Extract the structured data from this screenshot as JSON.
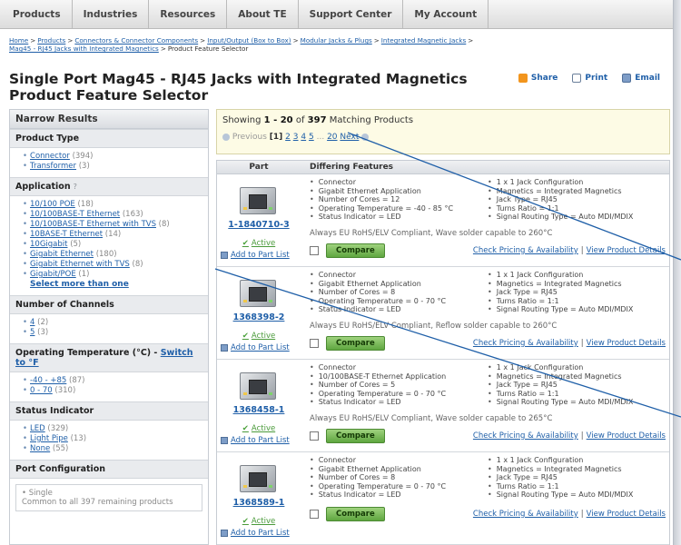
{
  "nav": {
    "items": [
      "Products",
      "Industries",
      "Resources",
      "About TE",
      "Support Center",
      "My Account"
    ]
  },
  "breadcrumb": {
    "links": [
      "Home",
      "Products",
      "Connectors & Connector Components",
      "Input/Output (Box to Box)",
      "Modular Jacks & Plugs",
      "Integrated Magnetic Jacks",
      "Mag45 - RJ45 Jacks with Integrated Magnetics"
    ],
    "current": "Product Feature Selector",
    "separator": ">"
  },
  "title": {
    "line1": "Single Port Mag45 - RJ45 Jacks with Integrated Magnetics",
    "line2": "Product Feature Selector"
  },
  "actions": {
    "share": "Share",
    "print": "Print",
    "email": "Email"
  },
  "sidebar": {
    "header": "Narrow Results",
    "product_type": {
      "title": "Product Type",
      "items": [
        {
          "label": "Connector",
          "count": "(394)"
        },
        {
          "label": "Transformer",
          "count": "(3)"
        }
      ]
    },
    "application": {
      "title": "Application",
      "help": "?",
      "items": [
        {
          "label": "10/100 POE",
          "count": "(18)"
        },
        {
          "label": "10/100BASE-T Ethernet",
          "count": "(163)"
        },
        {
          "label": "10/100BASE-T Ethernet with TVS",
          "count": "(8)"
        },
        {
          "label": "10BASE-T Ethernet",
          "count": "(14)"
        },
        {
          "label": "10Gigabit",
          "count": "(5)"
        },
        {
          "label": "Gigabit Ethernet",
          "count": "(180)"
        },
        {
          "label": "Gigabit Ethernet with TVS",
          "count": "(8)"
        },
        {
          "label": "Gigabit/POE",
          "count": "(1)"
        }
      ],
      "select_more": "Select more than one"
    },
    "channels": {
      "title": "Number of Channels",
      "items": [
        {
          "label": "4",
          "count": "(2)"
        },
        {
          "label": "5",
          "count": "(3)"
        }
      ]
    },
    "temperature": {
      "title": "Operating Temperature (°C) -",
      "switch": "Switch to °F",
      "items": [
        {
          "label": "-40 - +85",
          "count": "(87)"
        },
        {
          "label": "0 - 70",
          "count": "(310)"
        }
      ]
    },
    "status": {
      "title": "Status Indicator",
      "items": [
        {
          "label": "LED",
          "count": "(329)"
        },
        {
          "label": "Light Pipe",
          "count": "(13)"
        },
        {
          "label": "None",
          "count": "(55)"
        }
      ]
    },
    "port": {
      "title": "Port Configuration",
      "value": "Single",
      "note": "Common to all 397 remaining products"
    }
  },
  "results": {
    "showing_prefix": "Showing",
    "range": "1 - 20",
    "of": "of",
    "total": "397",
    "suffix": "Matching Products",
    "pager": {
      "previous": "Previous",
      "current": "[1]",
      "pages": [
        "2",
        "3",
        "4",
        "5"
      ],
      "ellipsis": "...",
      "last": "20",
      "next": "Next"
    },
    "columns": [
      "Part",
      "Differing Features"
    ],
    "rows": [
      {
        "part": "1-1840710-3",
        "status": "Active",
        "add": "Add to Part List",
        "left": [
          "Connector",
          "Gigabit Ethernet Application",
          "Number of Cores = 12",
          "Operating Temperature = -40 - 85 °C",
          "Status Indicator = LED"
        ],
        "right": [
          "1 x 1 Jack Configuration",
          "Magnetics = Integrated Magnetics",
          "Jack Type = RJ45",
          "Turns Ratio = 1:1",
          "Signal Routing Type = Auto MDI/MDIX"
        ],
        "rohs": "Always EU RoHS/ELV Compliant, Wave solder capable to 260°C",
        "compare": "Compare",
        "pricing": "Check Pricing & Availability",
        "details": "View Product Details"
      },
      {
        "part": "1368398-2",
        "status": "Active",
        "add": "Add to Part List",
        "left": [
          "Connector",
          "Gigabit Ethernet Application",
          "Number of Cores = 8",
          "Operating Temperature = 0 - 70 °C",
          "Status Indicator = LED"
        ],
        "right": [
          "1 x 1 Jack Configuration",
          "Magnetics = Integrated Magnetics",
          "Jack Type = RJ45",
          "Turns Ratio = 1:1",
          "Signal Routing Type = Auto MDI/MDIX"
        ],
        "rohs": "Always EU RoHS/ELV Compliant, Reflow solder capable to 260°C",
        "compare": "Compare",
        "pricing": "Check Pricing & Availability",
        "details": "View Product Details"
      },
      {
        "part": "1368458-1",
        "status": "Active",
        "add": "Add to Part List",
        "left": [
          "Connector",
          "10/100BASE-T Ethernet Application",
          "Number of Cores = 5",
          "Operating Temperature = 0 - 70 °C",
          "Status Indicator = LED"
        ],
        "right": [
          "1 x 1 Jack Configuration",
          "Magnetics = Integrated Magnetics",
          "Jack Type = RJ45",
          "Turns Ratio = 1:1",
          "Signal Routing Type = Auto MDI/MDIX"
        ],
        "rohs": "Always EU RoHS/ELV Compliant, Wave solder capable to 265°C",
        "compare": "Compare",
        "pricing": "Check Pricing & Availability",
        "details": "View Product Details"
      },
      {
        "part": "1368589-1",
        "status": "Active",
        "add": "Add to Part List",
        "left": [
          "Connector",
          "Gigabit Ethernet Application",
          "Number of Cores = 8",
          "Operating Temperature = 0 - 70 °C",
          "Status Indicator = LED"
        ],
        "right": [
          "1 x 1 Jack Configuration",
          "Magnetics = Integrated Magnetics",
          "Jack Type = RJ45",
          "Turns Ratio = 1:1",
          "Signal Routing Type = Auto MDI/MDIX"
        ],
        "rohs": "",
        "compare": "Compare",
        "pricing": "Check Pricing & Availability",
        "details": "View Product Details"
      }
    ]
  },
  "colors": {
    "link": "#1f5fa8",
    "compare_button": "#5fa640",
    "callout_line": "#1f5fa8",
    "highlight_box": "#fdfbe5"
  }
}
